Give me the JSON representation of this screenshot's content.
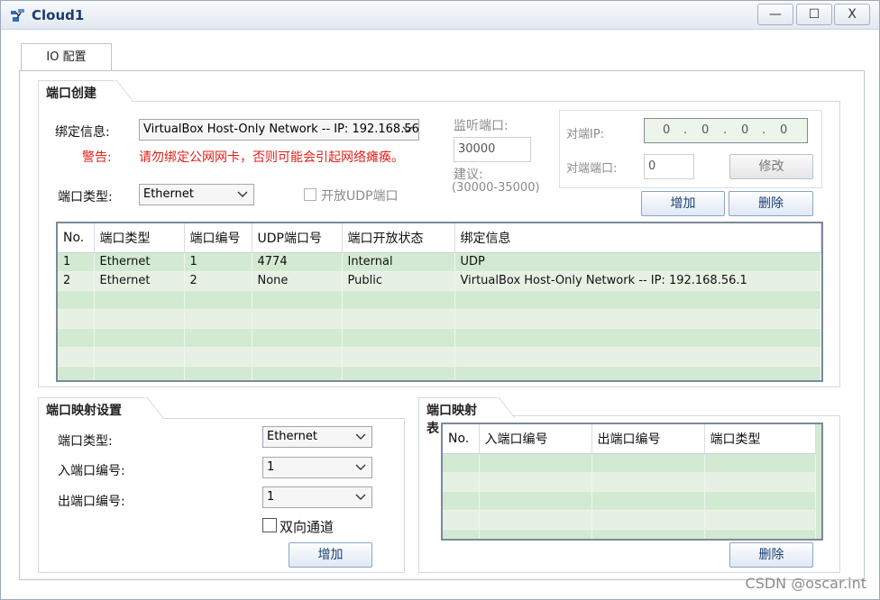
{
  "window": {
    "title": "Cloud1",
    "minimize": "—",
    "maximize": "☐",
    "close": "X"
  },
  "tabs": [
    "IO 配置"
  ],
  "port_create": {
    "section_title": "端口创建",
    "bind_label": "绑定信息:",
    "bind_value": "VirtualBox Host-Only Network -- IP: 192.168.56",
    "warning_label": "警告:",
    "warning_text": "请勿绑定公网网卡，否则可能会引起网络瘫痪。",
    "port_type_label": "端口类型:",
    "port_type_value": "Ethernet",
    "open_udp_label": "开放UDP端口",
    "listen_port_label": "监听端口:",
    "listen_port_value": "30000",
    "suggest_label": "建议:",
    "suggest_range": "(30000-35000)",
    "peer_ip_label": "对端IP:",
    "peer_ip_value": [
      "0",
      "0",
      "0",
      "0"
    ],
    "peer_port_label": "对端端口:",
    "peer_port_value": "0",
    "modify_button": "修改",
    "add_button": "增加",
    "delete_button": "删除",
    "table": {
      "headers": [
        "No.",
        "端口类型",
        "端口编号",
        "UDP端口号",
        "端口开放状态",
        "绑定信息"
      ],
      "rows": [
        [
          "1",
          "Ethernet",
          "1",
          "4774",
          "Internal",
          "UDP"
        ],
        [
          "2",
          "Ethernet",
          "2",
          "None",
          "Public",
          "VirtualBox Host-Only Network -- IP: 192.168.56.1"
        ]
      ]
    }
  },
  "port_mapping": {
    "section_title": "端口映射设置",
    "port_type_label": "端口类型:",
    "port_type_value": "Ethernet",
    "in_port_label": "入端口编号:",
    "in_port_value": "1",
    "out_port_label": "出端口编号:",
    "out_port_value": "1",
    "bidirectional_label": "双向通道",
    "add_button": "增加"
  },
  "mapping_table": {
    "section_title": "端口映射表",
    "headers": [
      "No.",
      "入端口编号",
      "出端口编号",
      "端口类型"
    ],
    "delete_button": "删除"
  },
  "watermark": "CSDN @oscar.int"
}
